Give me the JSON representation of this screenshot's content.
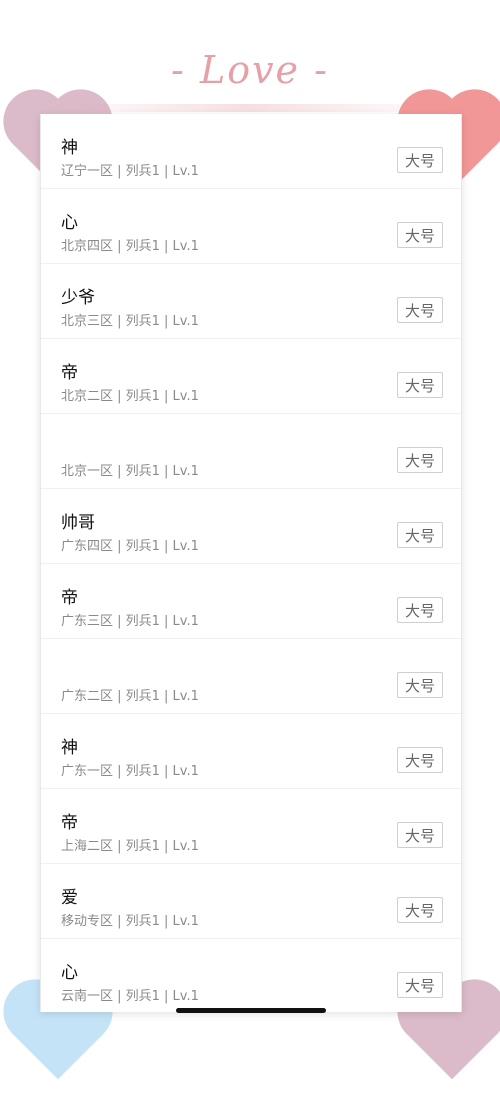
{
  "header": {
    "logo_text": "- Love -"
  },
  "list": {
    "items": [
      {
        "title": "神",
        "subtitle": "辽宁一区 | 列兵1 | Lv.1",
        "tag": "大号"
      },
      {
        "title": "心",
        "subtitle": "北京四区 | 列兵1 | Lv.1",
        "tag": "大号"
      },
      {
        "title": "少爷",
        "subtitle": "北京三区 | 列兵1 | Lv.1",
        "tag": "大号"
      },
      {
        "title": "帝",
        "subtitle": "北京二区 | 列兵1 | Lv.1",
        "tag": "大号"
      },
      {
        "title": "",
        "subtitle": "北京一区 | 列兵1 | Lv.1",
        "tag": "大号"
      },
      {
        "title": "帅哥",
        "subtitle": "广东四区 | 列兵1 | Lv.1",
        "tag": "大号"
      },
      {
        "title": "帝",
        "subtitle": "广东三区 | 列兵1 | Lv.1",
        "tag": "大号"
      },
      {
        "title": "",
        "subtitle": "广东二区 | 列兵1 | Lv.1",
        "tag": "大号"
      },
      {
        "title": "神",
        "subtitle": "广东一区 | 列兵1 | Lv.1",
        "tag": "大号"
      },
      {
        "title": "帝",
        "subtitle": "上海二区 | 列兵1 | Lv.1",
        "tag": "大号"
      },
      {
        "title": "爱",
        "subtitle": "移动专区 | 列兵1 | Lv.1",
        "tag": "大号"
      },
      {
        "title": "心",
        "subtitle": "云南一区 | 列兵1 | Lv.1",
        "tag": "大号"
      }
    ]
  },
  "colors": {
    "heart_pink": "#d8b4c4",
    "heart_red": "#f08c8c",
    "heart_blue": "#bfe0f7",
    "logo": "#e6a0a8"
  },
  "icons": {
    "decorations": [
      "heart-icon",
      "heart-icon",
      "heart-icon",
      "heart-icon"
    ]
  }
}
